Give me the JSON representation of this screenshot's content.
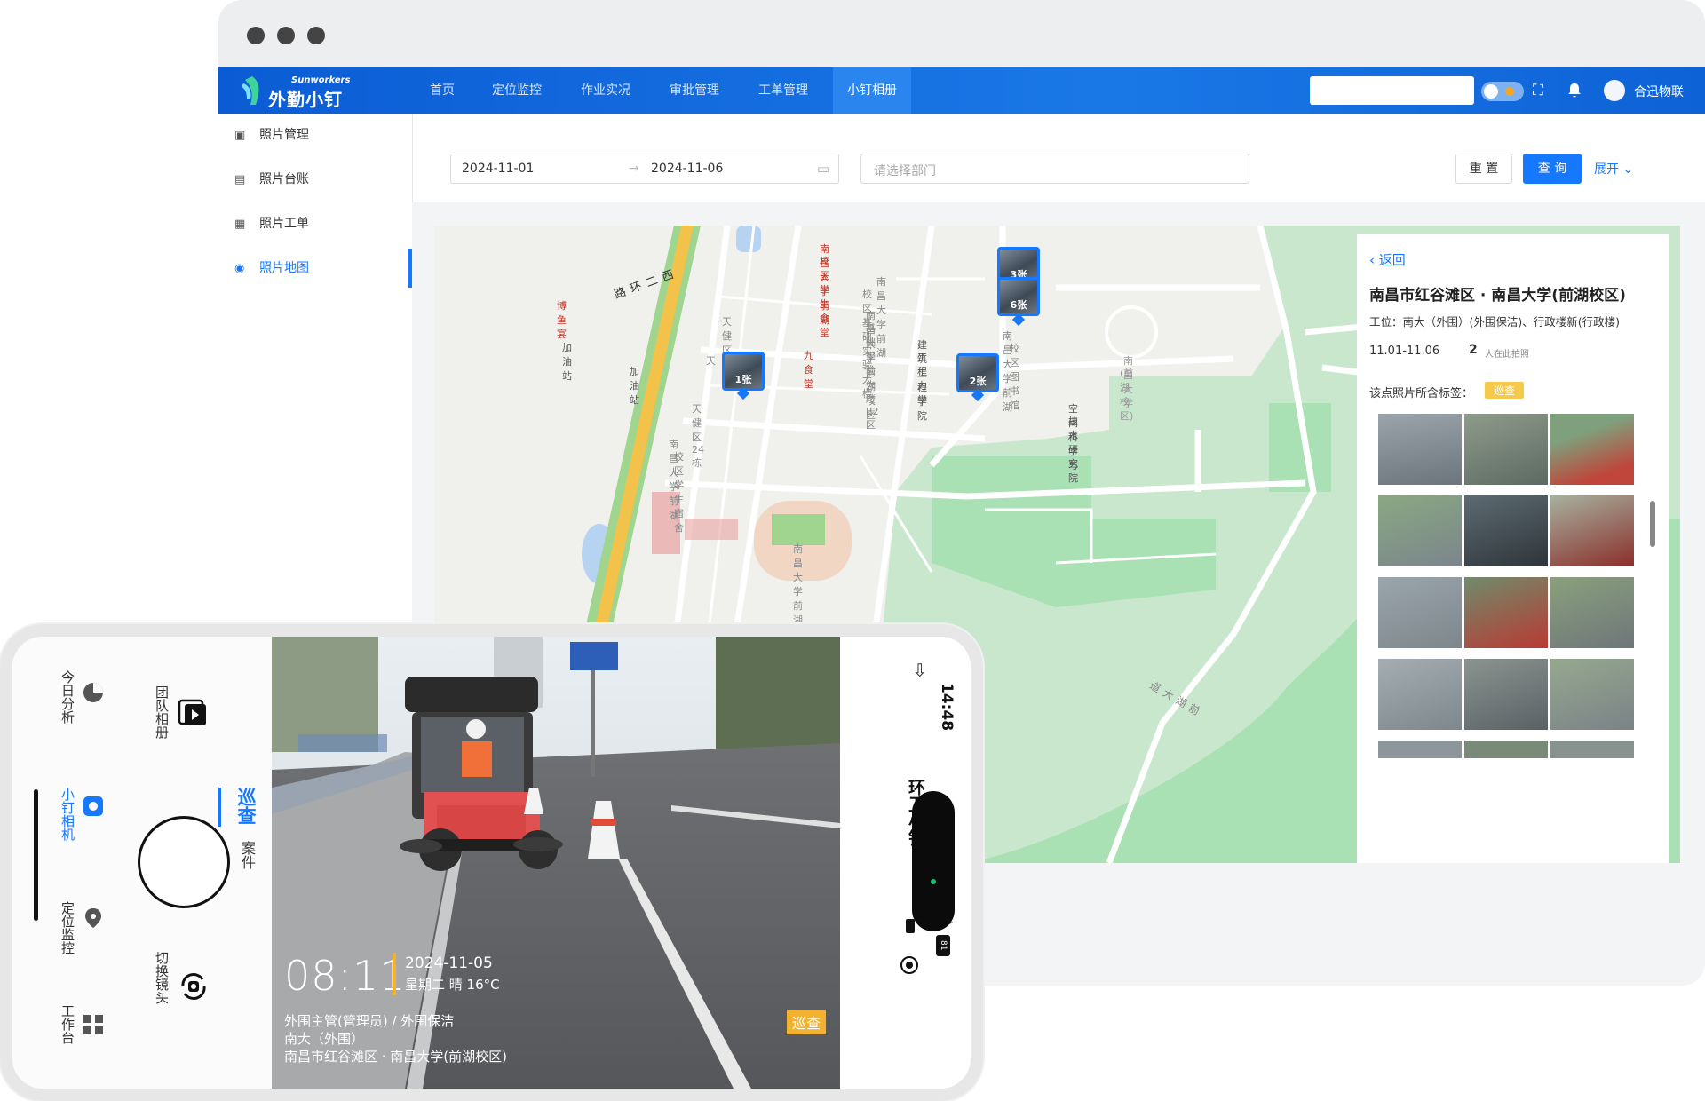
{
  "window": {
    "brand_sub": "Sunworkers",
    "brand": "外勤小钉"
  },
  "nav": {
    "items": [
      "首页",
      "定位监控",
      "作业实况",
      "审批管理",
      "工单管理",
      "小钉相册"
    ],
    "active": "小钉相册"
  },
  "header": {
    "username": "合迅物联"
  },
  "sidebar": {
    "items": [
      "照片管理",
      "照片台账",
      "照片工单",
      "照片地图"
    ],
    "active": "照片地图"
  },
  "filter": {
    "date_start": "2024-11-01",
    "date_sep": "→",
    "date_end": "2024-11-06",
    "dept_placeholder": "请选择部门",
    "reset": "重 置",
    "query": "查 询",
    "expand": "展开"
  },
  "map": {
    "labels": [
      "南昌大学前湖",
      "校区学生食堂",
      "南昌大学前湖",
      "校区基础实验大楼",
      "南昌大学前湖校区",
      "基础实验大楼B2区",
      "博鱼宴",
      "加油站",
      "加油站",
      "九食堂",
      "天健区22栋",
      "天健区24栋",
      "天",
      "建筑工程学院",
      "工程力学",
      "南昌大学前湖",
      "校区图书馆",
      "南昌大学",
      "(前湖校区)",
      "南昌大学前湖",
      "校区学生宿舍",
      "空间科学与",
      "技术研究院",
      "南昌大学前湖",
      "西二环路",
      "前湖大道"
    ],
    "markers": [
      "3张",
      "6张",
      "1张",
      "2张"
    ]
  },
  "info": {
    "back": "返回",
    "title": "南昌市红谷滩区 · 南昌大学(前湖校区)",
    "post": "工位：南大（外围）(外围保洁)、行政楼新(行政楼)",
    "date_range": "11.01-11.06",
    "count": "2",
    "count_label": "人在此拍照",
    "tag_label": "该点照片所含标签：",
    "tag": "巡查"
  },
  "phone": {
    "time": "14:48",
    "app_name": "环卫小钉",
    "battery": "81",
    "tabs": [
      "今日分析",
      "小钉相机",
      "定位监控",
      "工作台"
    ],
    "active_tab": "小钉相机",
    "team_album": "团队相册",
    "mode_active": "巡查",
    "mode_other": "案件",
    "switch_camera": "切换镜头",
    "overlay": {
      "time": "08:11",
      "date": "2024-11-05",
      "weather": "星期二 晴 16°C",
      "line1": "外围主管(管理员) / 外围保洁",
      "line2": "南大（外围）",
      "line3": "南昌市红谷滩区 · 南昌大学(前湖校区)",
      "badge": "巡查"
    }
  },
  "colors": {
    "primary": "#1677ff",
    "nav": "#0b5cd4",
    "tag": "#f6c94a",
    "overlay_accent": "#f2b22f"
  }
}
